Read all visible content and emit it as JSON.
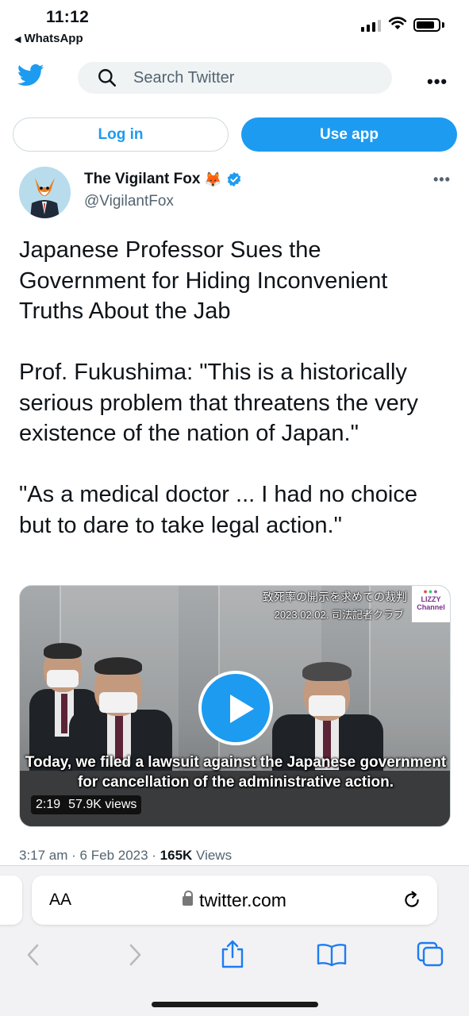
{
  "status_bar": {
    "time": "11:12",
    "back_app": "WhatsApp"
  },
  "twitter": {
    "search_placeholder": "Search Twitter",
    "more_label": "•••",
    "login_label": "Log in",
    "useapp_label": "Use app",
    "accent_color": "#1d9bf0"
  },
  "tweet": {
    "author_name": "The Vigilant Fox",
    "author_emoji": "🦊",
    "handle": "@VigilantFox",
    "more_label": "•••",
    "paragraphs": [
      "Japanese Professor Sues the Government for Hiding Inconvenient Truths About the Jab",
      "Prof. Fukushima: \"This is a historically serious problem that threatens the very existence of the nation of Japan.\"",
      "\"As a medical doctor ... I had no choice but to dare to take legal action.\""
    ],
    "video": {
      "jp_title": "致死率の開示を求めての裁判",
      "jp_date": "2023.02.02. 司法記者クラブ",
      "channel_line1": "LIZZY",
      "channel_line2": "Channel",
      "subtitle": "Today, we filed a lawsuit against the Japanese government for cancellation of the administrative action.",
      "duration": "2:19",
      "views": "57.9K views"
    },
    "time": "3:17 am",
    "date": "6 Feb 2023",
    "views_count": "165K",
    "views_label": "Views"
  },
  "safari": {
    "aa_label": "AA",
    "url": "twitter.com"
  }
}
